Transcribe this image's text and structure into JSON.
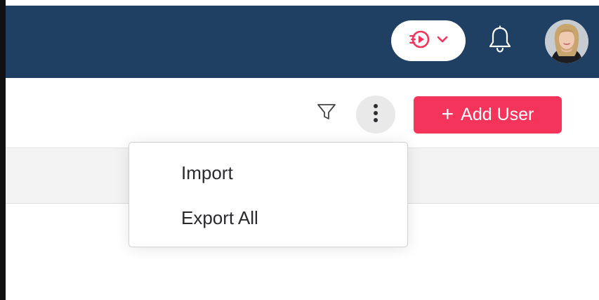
{
  "header": {
    "background": "#1f3f63",
    "product_switcher": {
      "icon": "product-play-icon",
      "chevron": "chevron-down-icon",
      "accent": "#f5345c"
    },
    "notifications": {
      "icon": "bell-icon"
    },
    "avatar": {
      "icon": "user-avatar"
    }
  },
  "toolbar": {
    "filter_icon": "filter-icon",
    "more_icon": "vertical-ellipsis-icon",
    "add_user_label": "Add User",
    "add_user_plus": "+",
    "add_user_color": "#f5345c"
  },
  "dropdown": {
    "items": [
      {
        "label": "Import"
      },
      {
        "label": "Export All"
      }
    ]
  }
}
